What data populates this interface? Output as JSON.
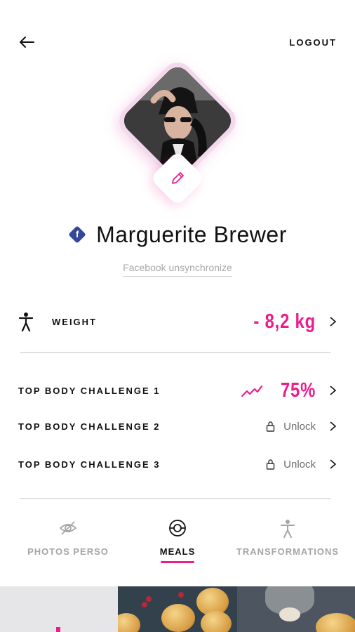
{
  "header": {
    "logout_label": "LOGOUT",
    "back_icon": "arrow-left-icon"
  },
  "profile": {
    "name": "Marguerite Brewer",
    "facebook_badge_letter": "f",
    "unsync_label": "Facebook unsynchronize",
    "edit_icon": "pencil-icon"
  },
  "stats": {
    "weight": {
      "label": "WEIGHT",
      "value": "- 8,2 kg",
      "icon": "person-icon"
    },
    "challenges": [
      {
        "label": "TOP BODY CHALLENGE 1",
        "value": "75%",
        "icon": "trend-icon",
        "locked": false
      },
      {
        "label": "TOP BODY CHALLENGE 2",
        "value": "Unlock",
        "icon": "lock-icon",
        "locked": true
      },
      {
        "label": "TOP BODY CHALLENGE 3",
        "value": "Unlock",
        "icon": "lock-icon",
        "locked": true
      }
    ]
  },
  "tabs": [
    {
      "label": "PHOTOS PERSO",
      "icon": "eye-off-icon",
      "active": false
    },
    {
      "label": "MEALS",
      "icon": "plate-icon",
      "active": true
    },
    {
      "label": "TRANSFORMATIONS",
      "icon": "person-icon",
      "active": false
    }
  ],
  "colors": {
    "accent": "#ec1c8c",
    "facebook": "#34489a",
    "divider": "#e2e2e2",
    "muted_text": "#a5a5a5"
  }
}
